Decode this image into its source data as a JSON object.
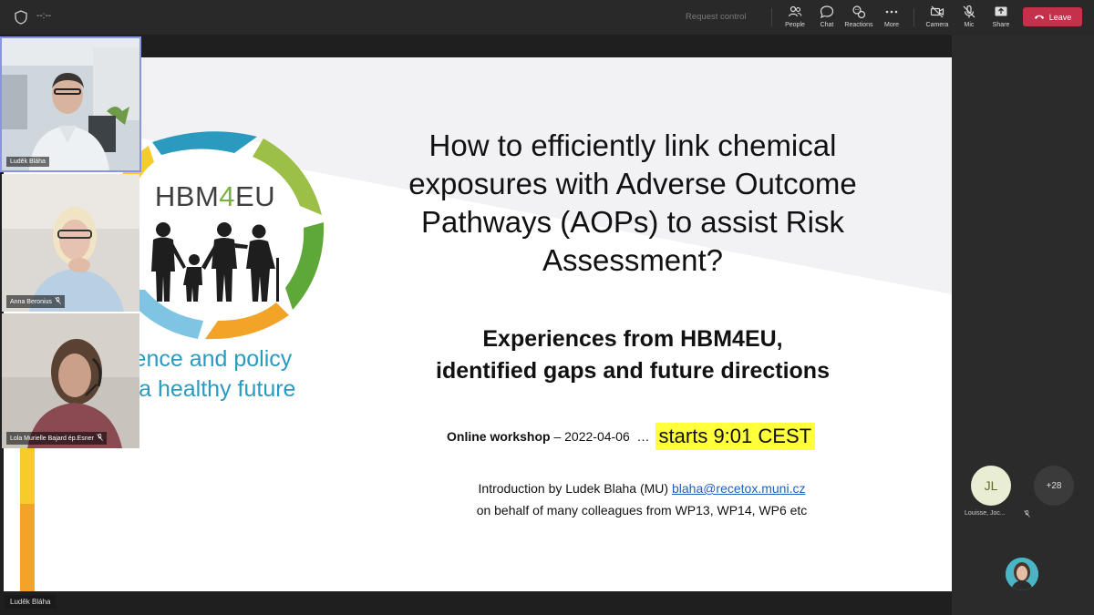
{
  "topbar": {
    "timer": "--:--",
    "request_control": "Request control",
    "buttons": {
      "people": "People",
      "chat": "Chat",
      "reactions": "Reactions",
      "more": "More",
      "camera": "Camera",
      "mic": "Mic",
      "share": "Share",
      "leave": "Leave"
    }
  },
  "slide": {
    "logo_name_prefix": "HBM",
    "logo_name_four": "4",
    "logo_name_suffix": "EU",
    "tagline_line1": "science and policy",
    "tagline_line2": "for a healthy future",
    "title_lines": [
      "How to efficiently link chemical",
      "exposures with Adverse Outcome",
      "Pathways (AOPs) to assist Risk",
      "Assessment?"
    ],
    "subtitle_lines": [
      "Experiences from HBM4EU,",
      "identified gaps and future directions"
    ],
    "workshop_label": "Online workshop",
    "workshop_date": " – 2022-04-06  …",
    "starts": "starts 9:01 CEST",
    "intro_prefix": "Introduction by Ludek Blaha (MU) ",
    "intro_email": "blaha@recetox.muni.cz",
    "intro_line2": "on behalf of many colleagues from WP13, WP14, WP6 etc"
  },
  "presenter_name": "Luděk Bláha",
  "participants": {
    "tile1_name": "Luděk Bláha",
    "tile2_name": "Anna Beronius",
    "tile3_name": "Lola Murielle Bajard ép.Esner",
    "jl_initials": "JL",
    "jl_name": "Louisse, Joc...",
    "more_count": "+28"
  },
  "colors": {
    "leave": "#c4314b",
    "accent_green": "#7bb33a",
    "accent_blue": "#2a9bbf",
    "highlight": "#ffff3c",
    "active_outline": "#8b93e8"
  }
}
